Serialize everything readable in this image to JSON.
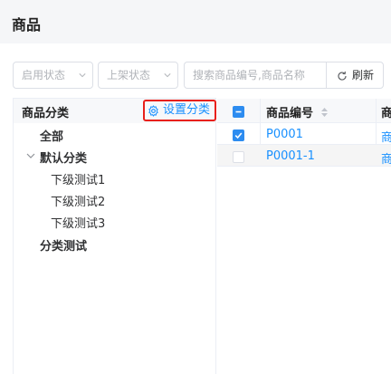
{
  "page": {
    "title": "商品"
  },
  "filters": {
    "enable_status": "启用状态",
    "shelf_status": "上架状态",
    "search_placeholder": "搜索商品编号,商品名称",
    "refresh_label": "刷新"
  },
  "category_panel": {
    "title": "商品分类",
    "set_category_label": "设置分类",
    "tree": {
      "all": "全部",
      "default": "默认分类",
      "children": [
        "下级测试1",
        "下级测试2",
        "下级测试3"
      ],
      "test": "分类测试"
    }
  },
  "table": {
    "headers": {
      "code": "商品编号",
      "next": "商"
    },
    "rows": [
      {
        "code": "P0001",
        "next": "商",
        "checked": true
      },
      {
        "code": "P0001-1",
        "next": "商",
        "checked": false
      }
    ]
  },
  "colors": {
    "accent": "#1890ff",
    "highlight_border": "#e8201a",
    "checkbox": "#2d8cf0"
  }
}
